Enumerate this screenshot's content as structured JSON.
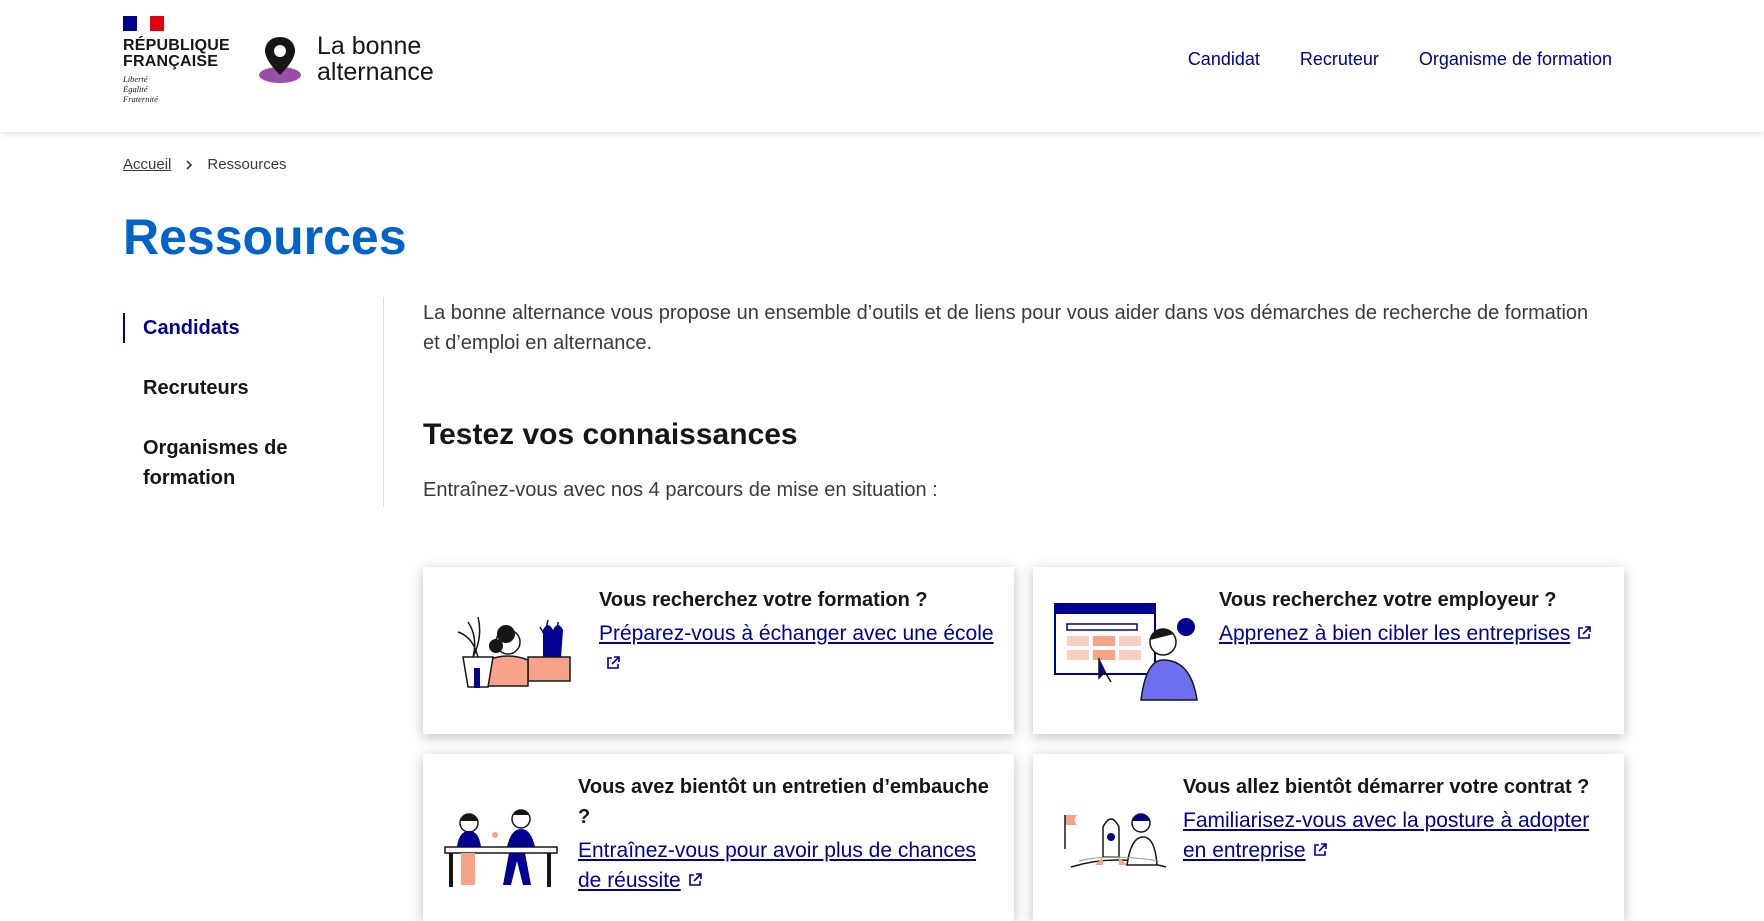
{
  "header": {
    "rf_name_line1": "RÉPUBLIQUE",
    "rf_name_line2": "FRANÇAISE",
    "rf_motto_line1": "Liberté",
    "rf_motto_line2": "Égalité",
    "rf_motto_line3": "Fraternité",
    "brand_line1": "La bonne",
    "brand_line2": "alternance",
    "nav": [
      "Candidat",
      "Recruteur",
      "Organisme de formation"
    ]
  },
  "breadcrumb": {
    "home": "Accueil",
    "current": "Ressources"
  },
  "page_title": "Ressources",
  "side_menu": {
    "items": [
      {
        "label": "Candidats",
        "active": true
      },
      {
        "label": "Recruteurs",
        "active": false
      },
      {
        "label": "Organismes de formation",
        "active": false
      }
    ]
  },
  "content": {
    "intro": "La bonne alternance vous propose un ensemble d’outils et de liens pour vous aider dans vos démarches de recherche de formation et d’emploi en alternance.",
    "section_title": "Testez vos connaissances",
    "section_sub": "Entraînez-vous avec nos 4 parcours de mise en situation :",
    "cards": [
      {
        "question": "Vous recherchez votre formation ?",
        "link": "Préparez-vous à échanger avec une école"
      },
      {
        "question": "Vous recherchez votre employeur ?",
        "link": "Apprenez à bien cibler les entreprises"
      },
      {
        "question": "Vous avez bientôt un entretien d’embauche ?",
        "link": "Entraînez-vous pour avoir plus de chances de réussite"
      },
      {
        "question": "Vous allez bientôt démarrer votre contrat ?",
        "link": "Familiarisez-vous avec la posture à adopter en entreprise"
      }
    ]
  },
  "colors": {
    "blue_france": "#000091",
    "title_blue": "#0063cb",
    "marianne_red": "#e1000f",
    "brand_purple": "#9a4fa6",
    "illustration_peach": "#f7a38a"
  },
  "icons": [
    "marianne-flag-icon",
    "map-pin-icon",
    "external-link-icon",
    "chevron-right-icon"
  ]
}
